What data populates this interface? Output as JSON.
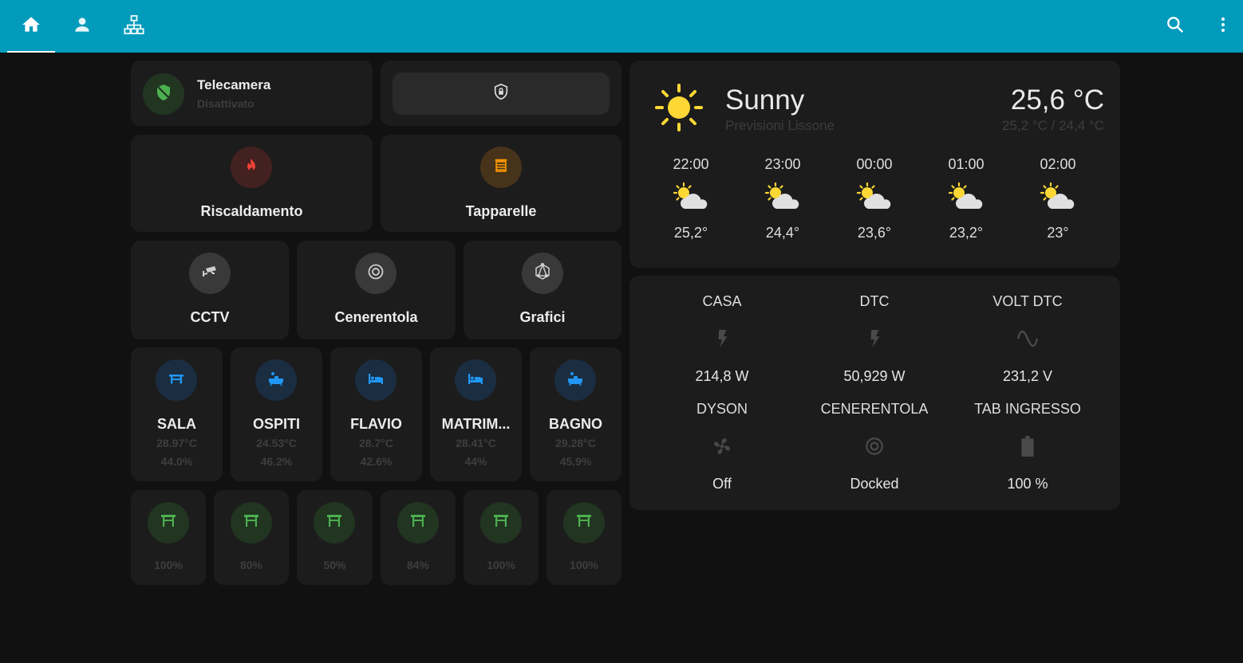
{
  "topbar": {
    "tabs": [
      {
        "icon": "home-icon",
        "active": true
      },
      {
        "icon": "person-icon",
        "active": false
      },
      {
        "icon": "network-icon",
        "active": false
      }
    ],
    "search_icon": "search-icon",
    "menu_icon": "more-vert-icon",
    "colors": {
      "background": "#039bbc"
    }
  },
  "alarm": {
    "name": "Telecamera",
    "state": "Disattivato",
    "icon": "shield-off-icon",
    "lock_icon": "shield-lock-icon"
  },
  "nav_large": [
    {
      "label": "Riscaldamento",
      "icon": "fire-icon",
      "color": "#f44336"
    },
    {
      "label": "Tapparelle",
      "icon": "blinds-icon",
      "color": "#ff9800"
    }
  ],
  "nav_small": [
    {
      "label": "CCTV",
      "icon": "cctv-icon"
    },
    {
      "label": "Cenerentola",
      "icon": "robot-vacuum-icon"
    },
    {
      "label": "Grafici",
      "icon": "graph-icon"
    }
  ],
  "rooms": [
    {
      "name": "SALA",
      "temp": "28.97°C",
      "humidity": "44.0%",
      "icon": "table-icon"
    },
    {
      "name": "OSPITI",
      "temp": "24.53°C",
      "humidity": "46.2%",
      "icon": "bath-icon"
    },
    {
      "name": "FLAVIO",
      "temp": "28.7°C",
      "humidity": "42.6%",
      "icon": "bed-icon"
    },
    {
      "name": "MATRIM...",
      "temp": "28.41°C",
      "humidity": "44%",
      "icon": "bed-icon"
    },
    {
      "name": "BAGNO",
      "temp": "29.28°C",
      "humidity": "45.9%",
      "icon": "bath-icon"
    }
  ],
  "blinds": [
    {
      "value": "100%",
      "icon": "window-shutter-icon"
    },
    {
      "value": "80%",
      "icon": "window-shutter-icon"
    },
    {
      "value": "50%",
      "icon": "window-shutter-icon"
    },
    {
      "value": "84%",
      "icon": "window-shutter-icon"
    },
    {
      "value": "100%",
      "icon": "window-shutter-icon"
    },
    {
      "value": "100%",
      "icon": "window-shutter-icon"
    }
  ],
  "weather": {
    "condition": "Sunny",
    "name": "Previsioni Lissone",
    "temperature": "25,6 °C",
    "hilo": "25,2 °C / 24,4 °C",
    "icon": "sunny-icon",
    "forecast": [
      {
        "time": "22:00",
        "temp": "25,2°",
        "icon": "partly-cloudy-icon"
      },
      {
        "time": "23:00",
        "temp": "24,4°",
        "icon": "partly-cloudy-icon"
      },
      {
        "time": "00:00",
        "temp": "23,6°",
        "icon": "partly-cloudy-icon"
      },
      {
        "time": "01:00",
        "temp": "23,2°",
        "icon": "partly-cloudy-icon"
      },
      {
        "time": "02:00",
        "temp": "23°",
        "icon": "partly-cloudy-icon"
      }
    ]
  },
  "entities": [
    {
      "name": "CASA",
      "value": "214,8 W",
      "icon": "flash-icon"
    },
    {
      "name": "DTC",
      "value": "50,929 W",
      "icon": "flash-icon"
    },
    {
      "name": "VOLT DTC",
      "value": "231,2 V",
      "icon": "sine-wave-icon"
    },
    {
      "name": "DYSON",
      "value": "Off",
      "icon": "fan-icon"
    },
    {
      "name": "CENERENTOLA",
      "value": "Docked",
      "icon": "robot-vacuum-icon"
    },
    {
      "name": "TAB INGRESSO",
      "value": "100 %",
      "icon": "battery-icon"
    }
  ]
}
